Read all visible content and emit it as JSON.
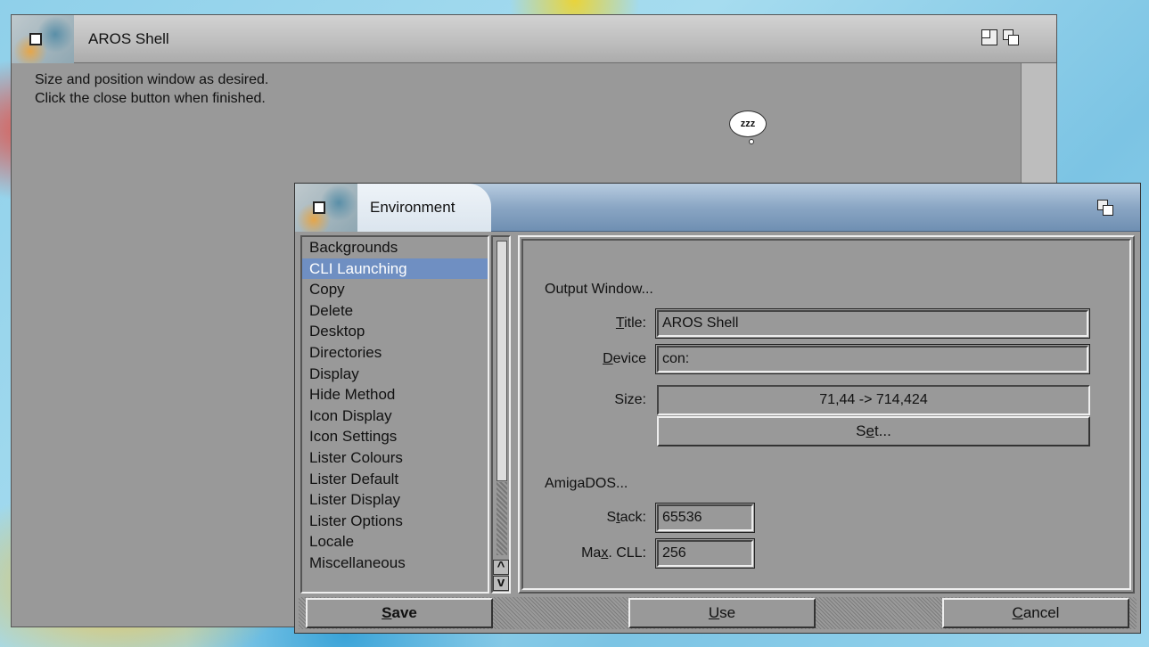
{
  "shell": {
    "title": "AROS Shell",
    "lines": [
      "Size and position window as desired.",
      "Click the close button when finished."
    ],
    "busy_text": "zzz"
  },
  "env": {
    "title": "Environment",
    "list_items": [
      "Backgrounds",
      "CLI Launching",
      "Copy",
      "Delete",
      "Desktop",
      "Directories",
      "Display",
      "Hide Method",
      "Icon Display",
      "Icon Settings",
      "Lister Colours",
      "Lister Default",
      "Lister Display",
      "Lister Options",
      "Locale",
      "Miscellaneous"
    ],
    "selected_item": "CLI Launching",
    "output_window_heading": "Output Window...",
    "title_label": {
      "pre": "",
      "u": "T",
      "post": "itle:"
    },
    "title_value": "AROS Shell",
    "device_label": {
      "pre": "",
      "u": "D",
      "post": "evice"
    },
    "device_value": "con:",
    "size_label": "Size:",
    "size_value": "71,44 -> 714,424",
    "set_button": {
      "pre": "S",
      "u": "e",
      "post": "t..."
    },
    "amigados_heading": "AmigaDOS...",
    "stack_label": {
      "pre": "S",
      "u": "t",
      "post": "ack:"
    },
    "stack_value": "65536",
    "maxcll_label": {
      "pre": "Ma",
      "u": "x",
      "post": ". CLL:"
    },
    "maxcll_value": "256",
    "save_button": {
      "pre": "",
      "u": "S",
      "post": "ave"
    },
    "use_button": {
      "pre": "",
      "u": "U",
      "post": "se"
    },
    "cancel_button": {
      "pre": "",
      "u": "C",
      "post": "ancel"
    },
    "arrow_up": "^",
    "arrow_down": "v"
  }
}
